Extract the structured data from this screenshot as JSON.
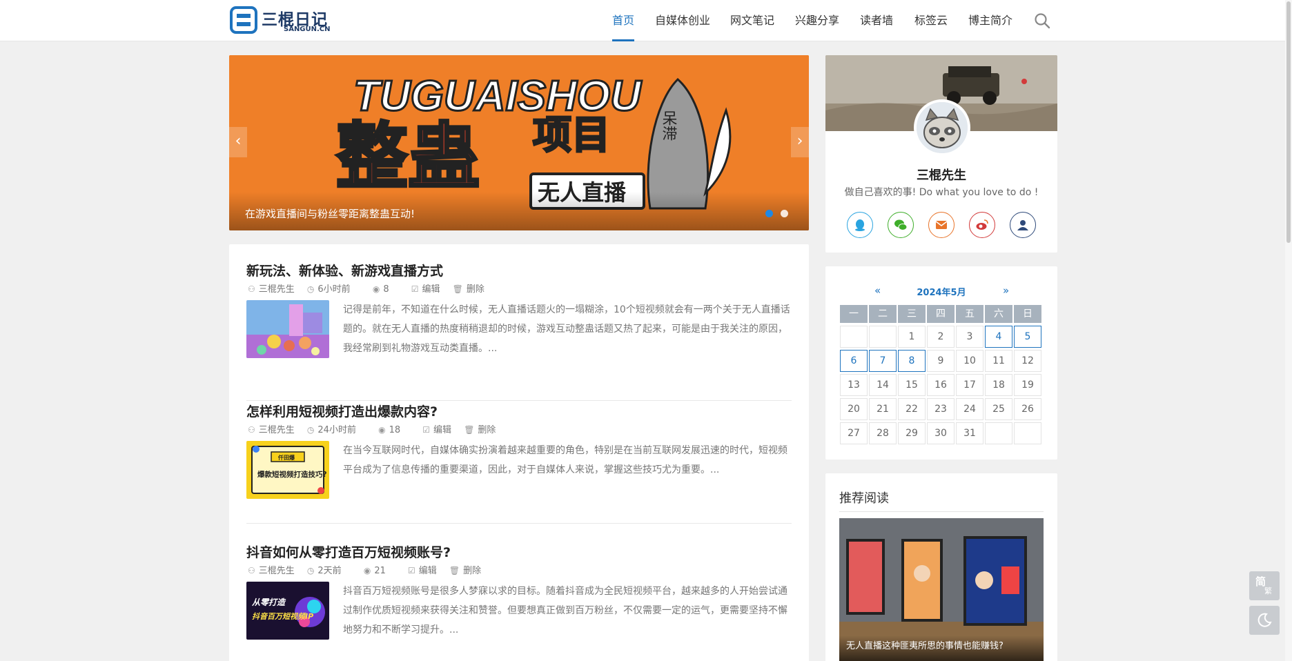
{
  "site": {
    "logo_text": "三棍日记",
    "logo_sub": "SANGUN.CN"
  },
  "nav": {
    "items": [
      {
        "label": "首页",
        "active": true
      },
      {
        "label": "自媒体创业",
        "active": false
      },
      {
        "label": "网文笔记",
        "active": false
      },
      {
        "label": "兴趣分享",
        "active": false
      },
      {
        "label": "读者墙",
        "active": false
      },
      {
        "label": "标签云",
        "active": false
      },
      {
        "label": "博主简介",
        "active": false
      }
    ],
    "search_icon": "search-icon"
  },
  "banner": {
    "text_top": "TUGUAISHOU",
    "text_main_1": "整蛊",
    "text_main_2": "项目",
    "text_badge": "无人直播",
    "text_vertical": "呆滞",
    "caption": "在游戏直播间与粉丝零距离整蛊互动!",
    "prev_symbol": "‹",
    "next_symbol": "›",
    "active_slide": 1,
    "slide_count": 2
  },
  "posts": [
    {
      "title": "新玩法、新体验、新游戏直播方式",
      "author": "三棍先生",
      "time": "6小时前",
      "views": "8",
      "edit": "编辑",
      "delete": "删除",
      "excerpt": "记得是前年，不知道在什么时候，无人直播话题火的一塌糊涂，10个短视频就会有一两个关于无人直播话题的。就在无人直播的热度稍稍退却的时候，游戏互动整蛊话题又热了起来，可能是由于我关注的原因，我经常刷到礼物游戏互动类直播。..."
    },
    {
      "title": "怎样利用短视频打造出爆款内容?",
      "author": "三棍先生",
      "time": "24小时前",
      "views": "18",
      "edit": "编辑",
      "delete": "删除",
      "excerpt": "在当今互联网时代，自媒体确实扮演着越来越重要的角色，特别是在当前互联网发展迅速的时代，短视频平台成为了信息传播的重要渠道，因此，对于自媒体人来说，掌握这些技巧尤为重要。...",
      "thumb_text_top": "仟田爆",
      "thumb_text": "爆款短视频打造技巧?"
    },
    {
      "title": "抖音如何从零打造百万短视频账号?",
      "author": "三棍先生",
      "time": "2天前",
      "views": "21",
      "edit": "编辑",
      "delete": "删除",
      "excerpt": "抖音百万短视频账号是很多人梦寐以求的目标。随着抖音成为全民短视频平台，越来越多的人开始尝试通过制作优质短视频来获得关注和赞誉。但要想真正做到百万粉丝，不仅需要一定的运气，更需要坚持不懈地努力和不断学习提升。...",
      "thumb_text_1": "从零打造",
      "thumb_text_2": "抖音百万短视频IP"
    }
  ],
  "profile": {
    "name": "三棍先生",
    "motto": "做自己喜欢的事! Do what you love to do !",
    "social": [
      {
        "name": "qq-icon",
        "color": "#2aa4e0"
      },
      {
        "name": "wechat-icon",
        "color": "#3fae2a"
      },
      {
        "name": "email-icon",
        "color": "#e8742a"
      },
      {
        "name": "weibo-icon",
        "color": "#d23a3a"
      },
      {
        "name": "user-icon",
        "color": "#2f4a7a"
      }
    ]
  },
  "calendar": {
    "prev": "«",
    "next": "»",
    "title": "2024年5月",
    "weekdays": [
      "一",
      "二",
      "三",
      "四",
      "五",
      "六",
      "日"
    ],
    "days": [
      [
        "",
        "",
        "1",
        "2",
        "3",
        "4",
        "5"
      ],
      [
        "6",
        "7",
        "8",
        "9",
        "10",
        "11",
        "12"
      ],
      [
        "13",
        "14",
        "15",
        "16",
        "17",
        "18",
        "19"
      ],
      [
        "20",
        "21",
        "22",
        "23",
        "24",
        "25",
        "26"
      ],
      [
        "27",
        "28",
        "29",
        "30",
        "31",
        "",
        ""
      ]
    ],
    "linked_days": [
      "4",
      "5",
      "6",
      "7",
      "8"
    ]
  },
  "recommend": {
    "title": "推荐阅读",
    "caption": "无人直播这种匪夷所思的事情也能赚钱?"
  },
  "floating": {
    "translate_label": "简",
    "translate_label_2": "繁",
    "theme_icon": "moon-icon"
  }
}
